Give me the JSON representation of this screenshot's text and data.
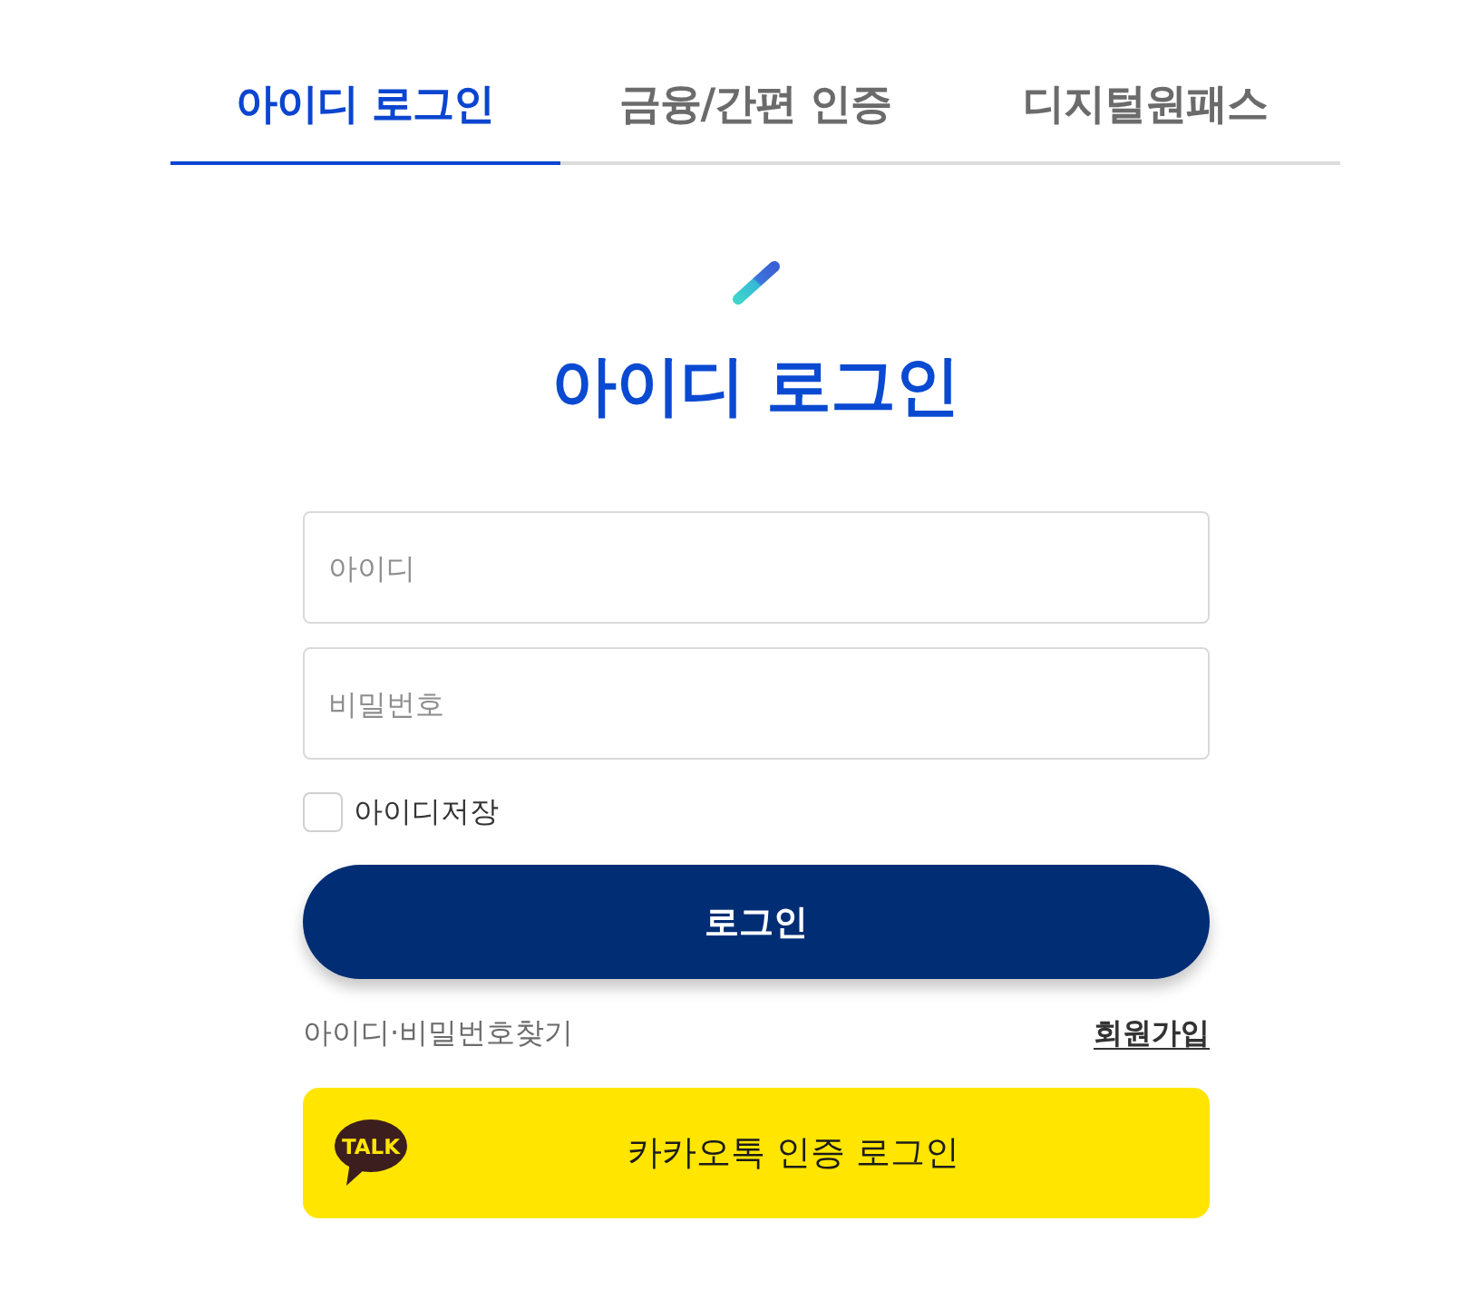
{
  "tabs": [
    {
      "label": "아이디 로그인",
      "selected": true
    },
    {
      "label": "금융/간편 인증",
      "selected": false
    },
    {
      "label": "디지털원패스",
      "selected": false
    }
  ],
  "heading": "아이디 로그인",
  "form": {
    "fields": [
      {
        "placeholder": "아이디"
      },
      {
        "placeholder": "비밀번호"
      }
    ],
    "remember": {
      "label": "아이디저장",
      "checked": false
    },
    "login_button": "로그인"
  },
  "links": {
    "find": "아이디·비밀번호찾기",
    "signup": "회원가입"
  },
  "kakao_button": {
    "badge": "TALK",
    "label": "카카오톡 인증 로그인"
  }
}
